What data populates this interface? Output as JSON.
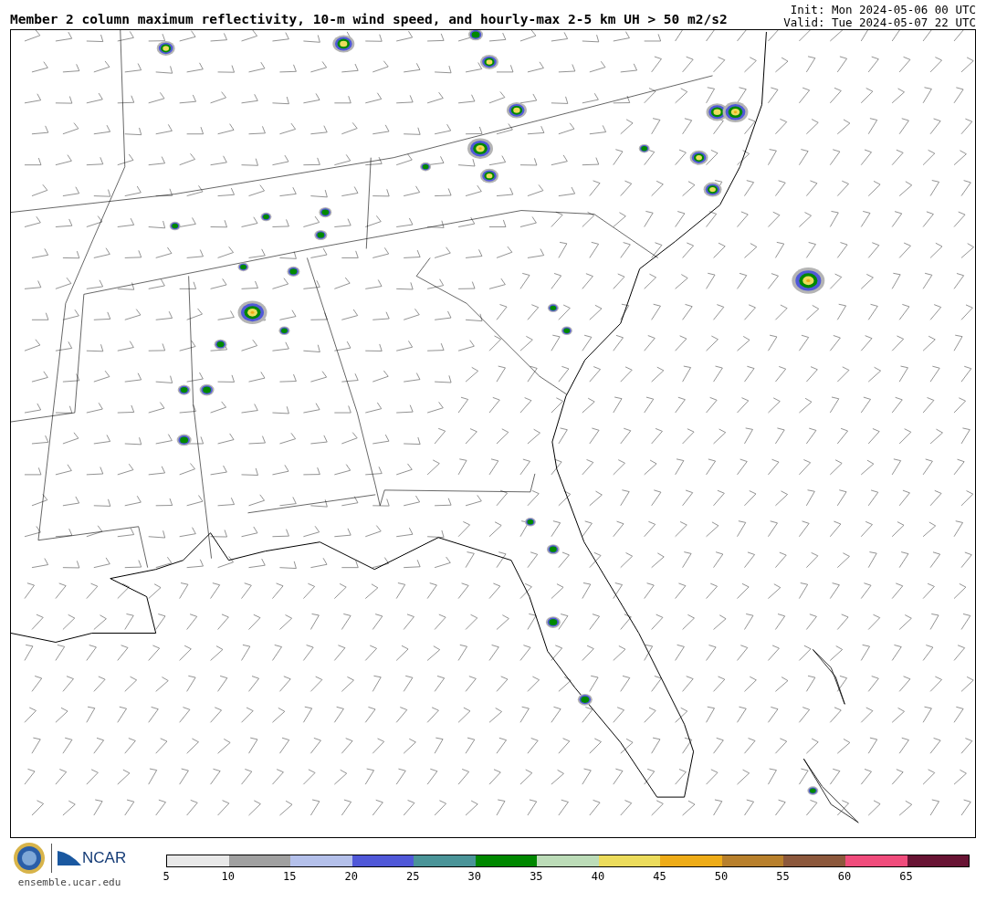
{
  "title": "Member 2 column maximum reflectivity, 10-m wind speed, and hourly-max 2-5 km UH > 50 m2/s2",
  "init": "Init: Mon 2024-05-06 00 UTC",
  "valid": "Valid: Tue 2024-05-07 22 UTC",
  "footer": {
    "logo_text": "NCAR",
    "url": "ensemble.ucar.edu"
  },
  "colorbar": {
    "swatches": [
      {
        "color": "#e8e8e8"
      },
      {
        "color": "#a0a0a0"
      },
      {
        "color": "#b4c0ea"
      },
      {
        "color": "#5058d8"
      },
      {
        "color": "#4a9498"
      },
      {
        "color": "#008800"
      },
      {
        "color": "#bcdcb8"
      },
      {
        "color": "#ecdc5c"
      },
      {
        "color": "#eeac18"
      },
      {
        "color": "#b8802c"
      },
      {
        "color": "#8c583c"
      },
      {
        "color": "#f04c7c"
      },
      {
        "color": "#681434"
      }
    ],
    "labels": [
      "5",
      "10",
      "15",
      "20",
      "25",
      "30",
      "35",
      "40",
      "45",
      "50",
      "55",
      "60",
      "65"
    ]
  }
}
